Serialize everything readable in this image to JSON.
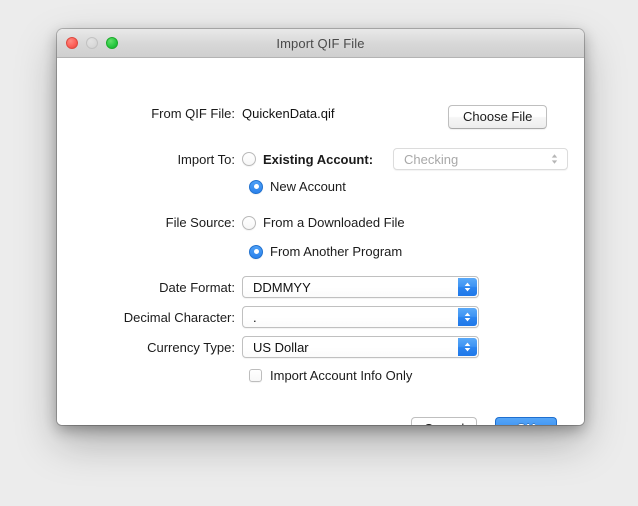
{
  "window": {
    "title": "Import QIF File",
    "controls": {
      "close": "close-button",
      "minimize": "minimize-button",
      "maximize": "maximize-button"
    }
  },
  "form": {
    "qif_file": {
      "label": "From QIF File:",
      "value": "QuickenData.qif",
      "choose_button": "Choose File"
    },
    "import_to": {
      "label": "Import To:",
      "existing_account_label": "Existing Account:",
      "existing_account_selected": false,
      "account_value": "Checking",
      "account_disabled": true,
      "new_account_label": "New Account",
      "new_account_selected": true
    },
    "file_source": {
      "label": "File Source:",
      "downloaded_label": "From a Downloaded File",
      "downloaded_selected": false,
      "another_program_label": "From Another Program",
      "another_program_selected": true
    },
    "date_format": {
      "label": "Date Format:",
      "value": "DDMMYY"
    },
    "decimal_character": {
      "label": "Decimal Character:",
      "value": "."
    },
    "currency_type": {
      "label": "Currency Type:",
      "value": "US Dollar"
    },
    "import_account_info_only": {
      "label": "Import Account Info Only",
      "checked": false
    }
  },
  "footer": {
    "cancel": "Cancel",
    "ok": "OK"
  },
  "colors": {
    "accent_blue": "#2b84ef",
    "close_red": "#fd5f57",
    "maximize_green": "#28c840",
    "minimize_gray": "#d9d9d9",
    "window_background": "#ffffff",
    "desktop_background": "#ececec"
  }
}
